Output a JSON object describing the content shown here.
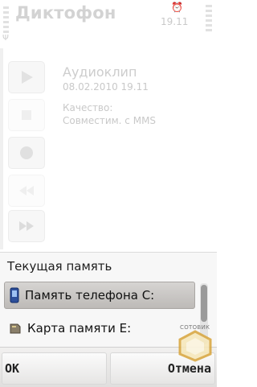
{
  "statusbar": {
    "app_title": "Диктофон",
    "time": "19.11"
  },
  "recording": {
    "name": "Аудиоклип",
    "datetime": "08.02.2010 19.11",
    "quality_label": "Качество:",
    "quality_value": "Совместим. с MMS"
  },
  "controls": [
    {
      "icon": "play-icon"
    },
    {
      "icon": "stop-icon"
    },
    {
      "icon": "record-icon"
    },
    {
      "icon": "rewind-icon"
    },
    {
      "icon": "fast-forward-icon"
    }
  ],
  "popup": {
    "title": "Текущая память",
    "options": [
      {
        "label": "Память телефона C:",
        "icon": "phone-memory-icon",
        "selected": true
      },
      {
        "label": "Карта памяти E:",
        "icon": "memory-card-icon",
        "selected": false
      }
    ]
  },
  "softkeys": {
    "left": "OK",
    "right": "Отмена"
  },
  "watermark": {
    "text": "СОТОВИК"
  }
}
